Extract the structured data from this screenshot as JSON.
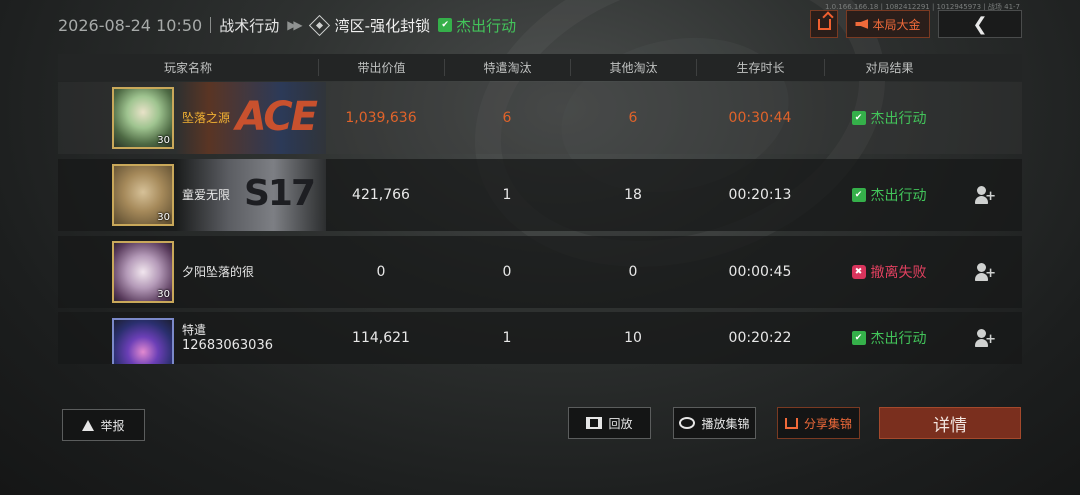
{
  "header": {
    "datetime": "2026-08-24 10:50",
    "mode": "战术行动",
    "map": "湾区-强化封锁",
    "result": "杰出行动",
    "gold_button": "本局大金",
    "back_glyph": "❮",
    "tiny_id": "1.0.166.166.18 | 1082412291 | 1012945973 | 战场 41-7"
  },
  "table": {
    "headers": [
      "玩家名称",
      "带出价值",
      "特遣淘汰",
      "其他淘汰",
      "生存时长",
      "对局结果"
    ],
    "rows": [
      {
        "name": "坠落之源",
        "level": "30",
        "banner": "ACE",
        "value": "1,039,636",
        "special_kills": "6",
        "other_kills": "6",
        "survival": "00:30:44",
        "result": "杰出行动"
      },
      {
        "name": "童爱无限",
        "level": "30",
        "banner": "S17",
        "value": "421,766",
        "special_kills": "1",
        "other_kills": "18",
        "survival": "00:20:13",
        "result": "杰出行动"
      },
      {
        "name": "夕阳坠落的很",
        "level": "30",
        "banner": "",
        "value": "0",
        "special_kills": "0",
        "other_kills": "0",
        "survival": "00:00:45",
        "result": "撤离失败"
      },
      {
        "name": "特遣",
        "name_line2": "12683063036",
        "level": "",
        "banner": "",
        "value": "114,621",
        "special_kills": "1",
        "other_kills": "10",
        "survival": "00:20:22",
        "result": "杰出行动"
      }
    ]
  },
  "buttons": {
    "report": "举报",
    "replay": "回放",
    "play_highlights": "播放集锦",
    "share_highlights": "分享集锦",
    "details": "详情"
  },
  "colors": {
    "accent": "#e0632a",
    "success": "#42c45a",
    "fail": "#e0405f",
    "self_name": "#f2b233",
    "detail_button": "#7a2f1e"
  },
  "icons": {
    "result_success": "thumbs-up-icon",
    "result_fail": "fail-icon",
    "add_friend": "add-friend-icon",
    "share": "share-icon",
    "gold": "speaker-icon",
    "back": "chevron-left-icon"
  }
}
